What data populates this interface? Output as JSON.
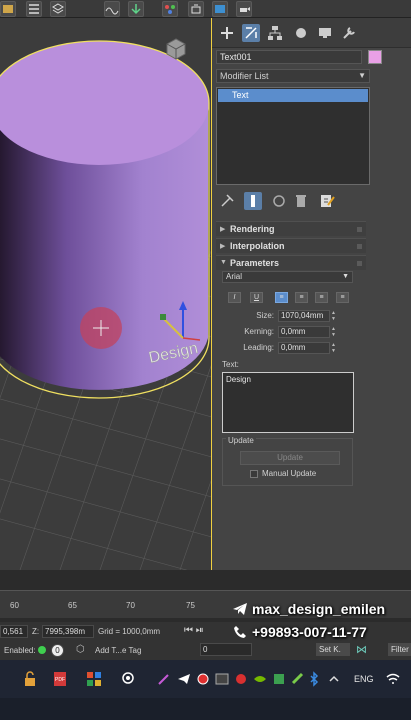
{
  "panel": {
    "object_name": "Text001",
    "modifier_list": "Modifier List",
    "stack_item": "Text",
    "rollouts": [
      "Rendering",
      "Interpolation",
      "Parameters"
    ],
    "font": "Arial",
    "size_label": "Size:",
    "size_value": "1070,04mm",
    "kerning_label": "Kerning:",
    "kerning_value": "0,0mm",
    "leading_label": "Leading:",
    "leading_value": "0,0mm",
    "text_label": "Text:",
    "text_value": "Design",
    "update_group_label": "Update",
    "update_button": "Update",
    "manual_update_label": "Manual Update"
  },
  "viewport": {
    "scene_text": "Design"
  },
  "timeline": {
    "ticks": [
      "60",
      "65",
      "70",
      "75"
    ]
  },
  "status": {
    "x_field": "0,561",
    "z_label": "Z:",
    "z_field": "7995,398m",
    "grid": "Grid = 1000,0mm",
    "enabled_label": "Enabled:",
    "enabled_value": "0",
    "add_tag": "Add T...e Tag",
    "frame_field": "0",
    "set_key": "Set K.",
    "filters": "Filter"
  },
  "taskbar": {
    "lang": "ENG"
  },
  "overlay": {
    "handle": "max_design_emilen",
    "phone": "+99893-007-11-77"
  },
  "colors": {
    "object_color": "#e9a0e6",
    "cylinder_top": "#b98fdc",
    "selection": "#f0e060",
    "active_tab": "#5b7fa8"
  }
}
